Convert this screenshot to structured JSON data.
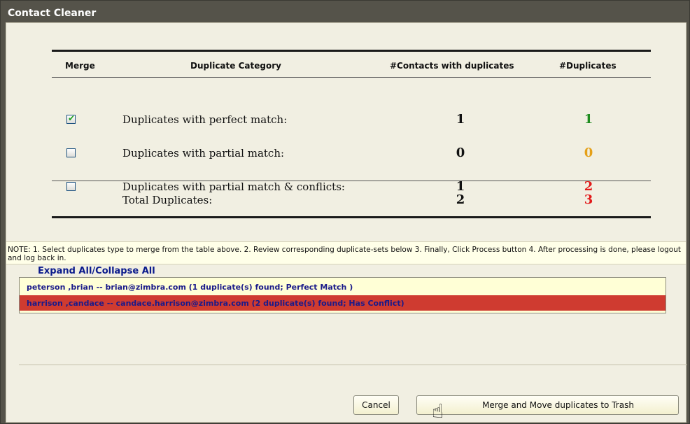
{
  "window": {
    "title": "Contact Cleaner"
  },
  "table": {
    "headers": {
      "merge": "Merge",
      "category": "Duplicate Category",
      "contacts": "#Contacts with duplicates",
      "duplicates": "#Duplicates"
    },
    "rows": [
      {
        "checked": true,
        "category": "Duplicates with perfect match:",
        "contacts": "1",
        "duplicates": "1",
        "dup_color": "#1e8c1e"
      },
      {
        "checked": false,
        "category": "Duplicates with partial match:",
        "contacts": "0",
        "duplicates": "0",
        "dup_color": "#e5a018"
      },
      {
        "checked": false,
        "category": "Duplicates with partial match & conflicts:",
        "contacts": "1",
        "duplicates": "2",
        "dup_color": "#e21a1a"
      }
    ],
    "total": {
      "label": "Total Duplicates:",
      "contacts": "2",
      "duplicates": "3",
      "dup_color": "#e21a1a"
    }
  },
  "note": "NOTE: 1. Select duplicates type to merge from the table above. 2. Review corresponding duplicate-sets below 3. Finally, Click Process button 4. After processing is done, please logout and log back in.",
  "expand_all": "Expand All/Collapse All",
  "duplicate_sets": [
    {
      "text": "peterson ,brian -- brian@zimbra.com (1 duplicate(s) found; Perfect Match )",
      "status": "perfect"
    },
    {
      "text": "harrison ,candace -- candace.harrison@zimbra.com (2 duplicate(s) found; Has Conflict)",
      "status": "conflict"
    }
  ],
  "buttons": {
    "cancel": "Cancel",
    "merge": "Merge and Move duplicates to Trash"
  },
  "icons": {
    "checkbox_tick": "✔",
    "hand_cursor": "☝"
  }
}
